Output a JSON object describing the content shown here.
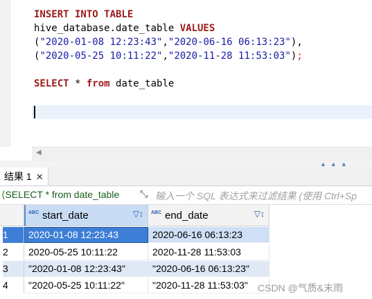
{
  "editor": {
    "line1_kw": "INSERT INTO TABLE",
    "line2_plain": "hive_database.date_table ",
    "line2_kw": "VALUES",
    "line3_open": "(",
    "line3_s1": "\"2020-01-08 12:23:43\"",
    "line3_comma": ",",
    "line3_s2": "\"2020-06-16 06:13:23\"",
    "line3_close": "),",
    "line4_open": "(",
    "line4_s1": "\"2020-05-25 10:11:22\"",
    "line4_comma": ",",
    "line4_s2": "\"2020-11-28 11:53:03\"",
    "line4_close": ")",
    "line4_semi": ";",
    "line6_kw1": "SELECT",
    "line6_mid": " * ",
    "line6_kw2": "from",
    "line6_rest": " date_table"
  },
  "results_tab": {
    "label": "结果 1",
    "close": "✕"
  },
  "filter": {
    "query": "SELECT * from date_table",
    "placeholder": "输入一个 SQL 表达式来过滤结果 (使用 Ctrl+Sp"
  },
  "grid": {
    "columns": [
      {
        "name": "start_date",
        "type_badge": "ABC"
      },
      {
        "name": "end_date",
        "type_badge": "ABC"
      }
    ],
    "rows": [
      {
        "num": "1",
        "a": "2020-01-08 12:23:43",
        "b": "2020-06-16 06:13:23"
      },
      {
        "num": "2",
        "a": "2020-05-25 10:11:22",
        "b": "2020-11-28 11:53:03"
      },
      {
        "num": "3",
        "a": "\"2020-01-08 12:23:43\"",
        "b": "\"2020-06-16 06:13:23\""
      },
      {
        "num": "4",
        "a": "\"2020-05-25 10:11:22\"",
        "b": "\"2020-11-28 11:53:03\""
      }
    ]
  },
  "watermark": "CSDN @气质&末雨",
  "colors": {
    "keyword": "#9b1a1a",
    "string": "#1a1aa6",
    "selection": "#3d7fd6"
  }
}
